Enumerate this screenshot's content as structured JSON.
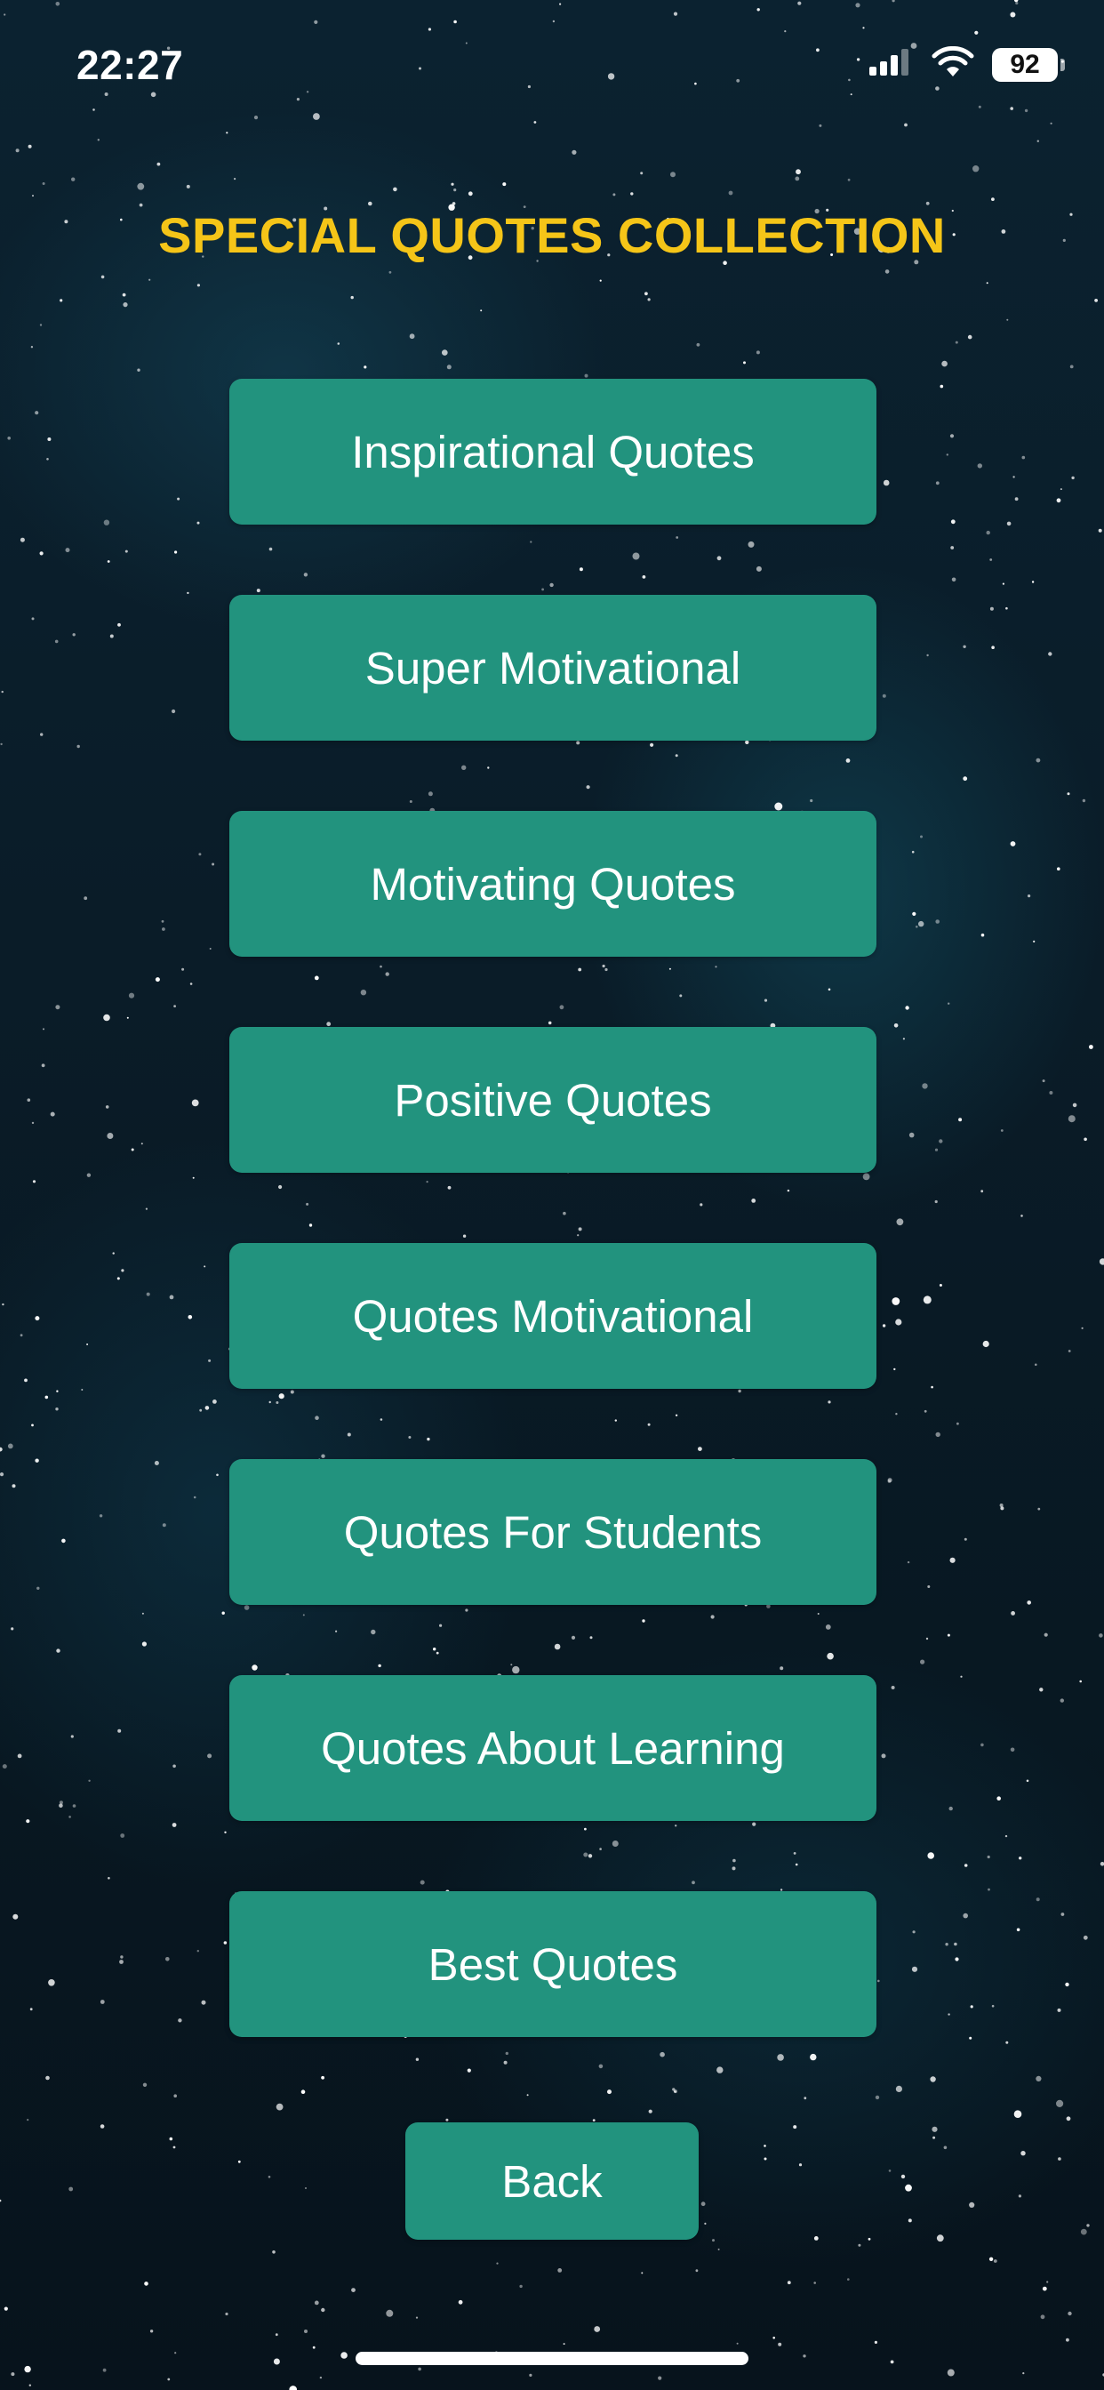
{
  "status_bar": {
    "time": "22:27",
    "battery": "92",
    "icons": [
      "cellular-signal-icon",
      "wifi-icon",
      "battery-icon"
    ]
  },
  "title": "SPECIAL QUOTES COLLECTION",
  "menu": {
    "items": [
      {
        "label": "Inspirational Quotes"
      },
      {
        "label": "Super Motivational"
      },
      {
        "label": "Motivating Quotes"
      },
      {
        "label": "Positive Quotes"
      },
      {
        "label": "Quotes Motivational"
      },
      {
        "label": "Quotes For Students"
      },
      {
        "label": "Quotes About Learning"
      },
      {
        "label": "Best Quotes"
      }
    ]
  },
  "back_label": "Back",
  "colors": {
    "title": "#f5c518",
    "button": "#22937e",
    "background": "#0a1c28"
  }
}
